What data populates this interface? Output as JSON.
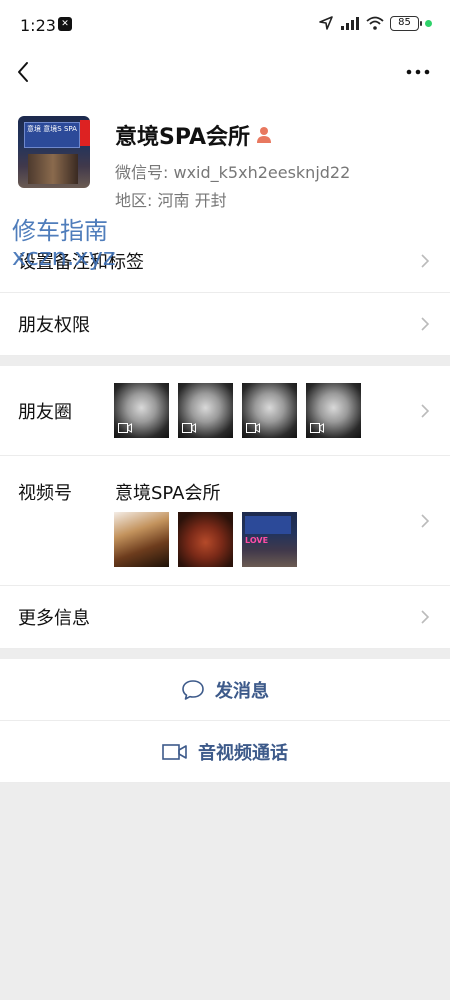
{
  "status": {
    "time": "1:23",
    "battery": "85"
  },
  "profile": {
    "name": "意境SPA会所",
    "wechat_id_label": "微信号:",
    "wechat_id": "wxid_k5xh2eesknjd22",
    "region_label": "地区:",
    "region": "河南  开封",
    "avatar_sign_text": "意境 意境S SPA"
  },
  "watermark": {
    "line1": "修车指南",
    "line2": "xczn.xyz"
  },
  "rows": {
    "remark_tags": "设置备注和标签",
    "friend_permissions": "朋友权限",
    "moments": "朋友圈",
    "channels": "视频号",
    "channels_name": "意境SPA会所",
    "more_info": "更多信息"
  },
  "channel_thumb_text": "LOVE",
  "actions": {
    "send_message": "发消息",
    "video_call": "音视频通话"
  },
  "colors": {
    "accent": "#3d5a8a",
    "background": "#ededed",
    "status_dot": "#2fd26a"
  },
  "icons": [
    "back-arrow-icon",
    "more-dots-icon",
    "gender-female-icon",
    "chevron-right-icon",
    "video-icon",
    "message-bubble-icon",
    "video-camera-icon"
  ]
}
